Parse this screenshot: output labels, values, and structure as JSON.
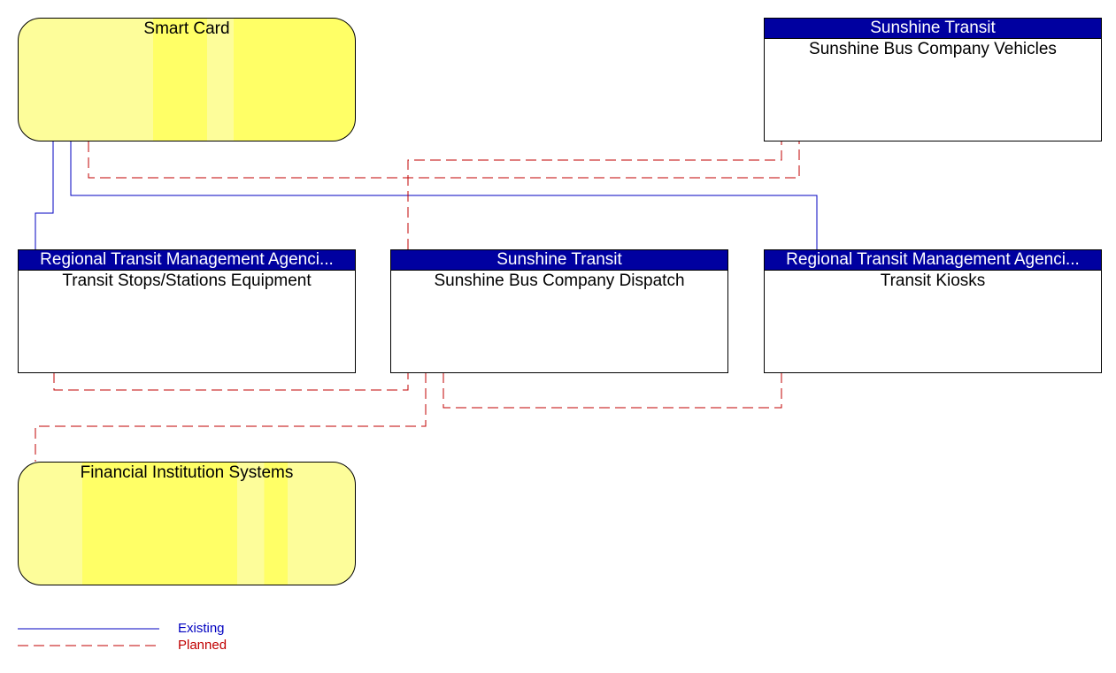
{
  "colors": {
    "existing": "#0000c0",
    "planned": "#c00000",
    "header": "#0000a0",
    "external": "#ffff66"
  },
  "nodes": {
    "smart_card": {
      "title": "Smart Card"
    },
    "vehicles": {
      "owner": "Sunshine Transit",
      "title": "Sunshine Bus Company Vehicles"
    },
    "stops": {
      "owner": "Regional Transit Management Agenci...",
      "title": "Transit Stops/Stations Equipment"
    },
    "dispatch": {
      "owner": "Sunshine Transit",
      "title": "Sunshine Bus Company Dispatch"
    },
    "kiosks": {
      "owner": "Regional Transit Management Agenci...",
      "title": "Transit Kiosks"
    },
    "financial": {
      "title": "Financial Institution Systems"
    }
  },
  "legend": {
    "existing": "Existing",
    "planned": "Planned"
  }
}
